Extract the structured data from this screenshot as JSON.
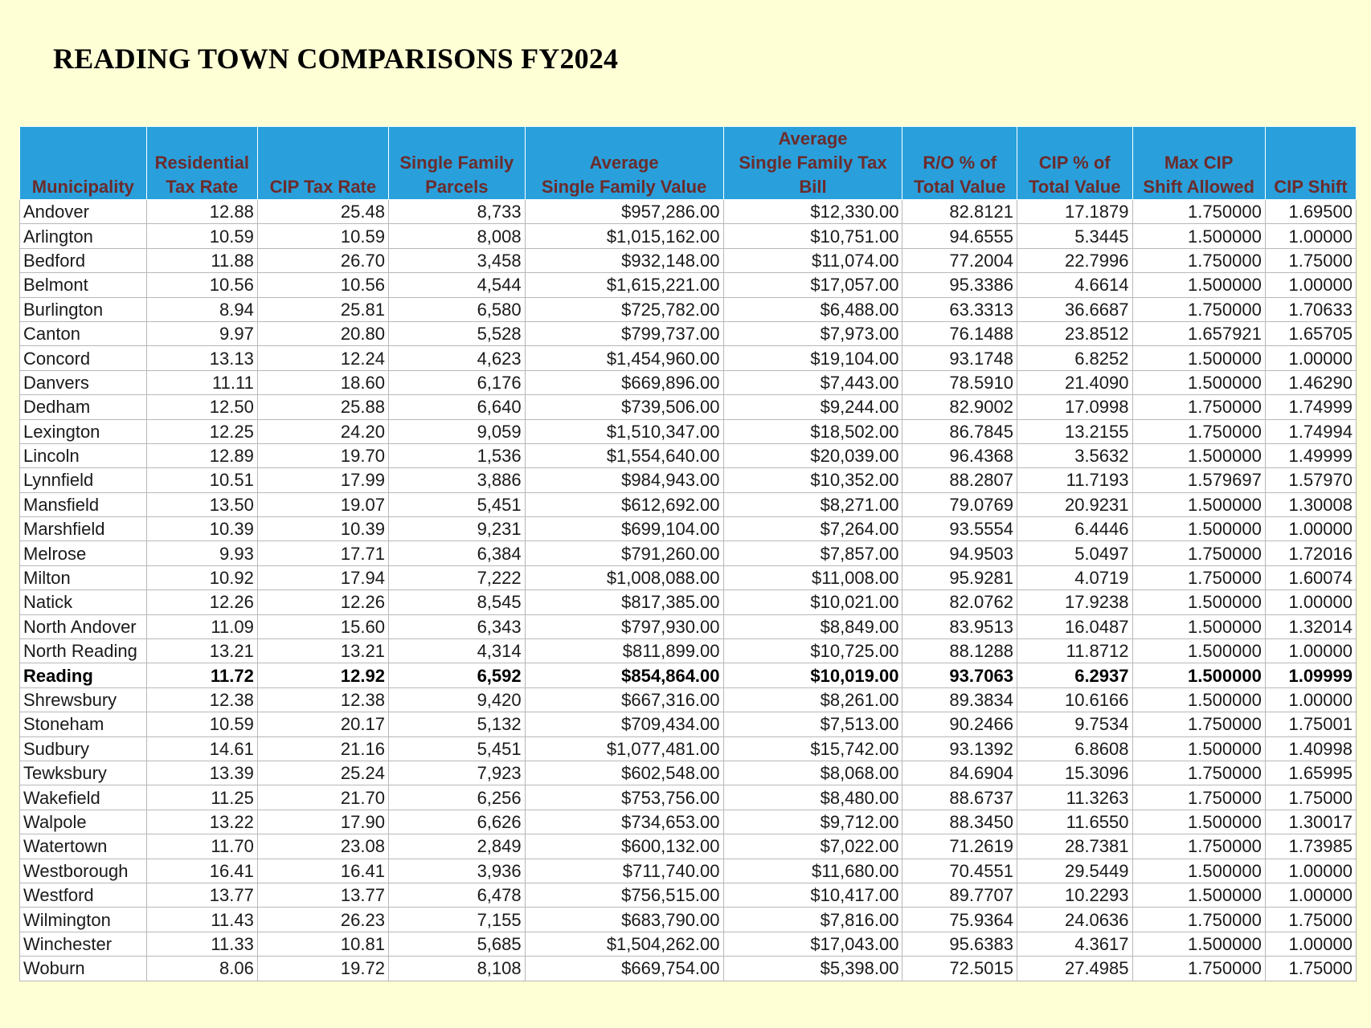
{
  "title": "READING TOWN COMPARISONS FY2024",
  "table": {
    "headers": [
      [
        "Municipality"
      ],
      [
        "Residential",
        "Tax Rate"
      ],
      [
        "CIP Tax Rate"
      ],
      [
        "Single Family",
        "Parcels"
      ],
      [
        "Average",
        "Single Family Value"
      ],
      [
        "Average",
        "Single Family Tax",
        "Bill"
      ],
      [
        "R/O % of",
        "Total Value"
      ],
      [
        "CIP % of",
        "Total Value"
      ],
      [
        "Max CIP",
        "Shift Allowed"
      ],
      [
        "CIP Shift"
      ]
    ],
    "highlight_row": "Reading",
    "rows": [
      [
        "Andover",
        "12.88",
        "25.48",
        "8,733",
        "$957,286.00",
        "$12,330.00",
        "82.8121",
        "17.1879",
        "1.750000",
        "1.69500"
      ],
      [
        "Arlington",
        "10.59",
        "10.59",
        "8,008",
        "$1,015,162.00",
        "$10,751.00",
        "94.6555",
        "5.3445",
        "1.500000",
        "1.00000"
      ],
      [
        "Bedford",
        "11.88",
        "26.70",
        "3,458",
        "$932,148.00",
        "$11,074.00",
        "77.2004",
        "22.7996",
        "1.750000",
        "1.75000"
      ],
      [
        "Belmont",
        "10.56",
        "10.56",
        "4,544",
        "$1,615,221.00",
        "$17,057.00",
        "95.3386",
        "4.6614",
        "1.500000",
        "1.00000"
      ],
      [
        "Burlington",
        "8.94",
        "25.81",
        "6,580",
        "$725,782.00",
        "$6,488.00",
        "63.3313",
        "36.6687",
        "1.750000",
        "1.70633"
      ],
      [
        "Canton",
        "9.97",
        "20.80",
        "5,528",
        "$799,737.00",
        "$7,973.00",
        "76.1488",
        "23.8512",
        "1.657921",
        "1.65705"
      ],
      [
        "Concord",
        "13.13",
        "12.24",
        "4,623",
        "$1,454,960.00",
        "$19,104.00",
        "93.1748",
        "6.8252",
        "1.500000",
        "1.00000"
      ],
      [
        "Danvers",
        "11.11",
        "18.60",
        "6,176",
        "$669,896.00",
        "$7,443.00",
        "78.5910",
        "21.4090",
        "1.500000",
        "1.46290"
      ],
      [
        "Dedham",
        "12.50",
        "25.88",
        "6,640",
        "$739,506.00",
        "$9,244.00",
        "82.9002",
        "17.0998",
        "1.750000",
        "1.74999"
      ],
      [
        "Lexington",
        "12.25",
        "24.20",
        "9,059",
        "$1,510,347.00",
        "$18,502.00",
        "86.7845",
        "13.2155",
        "1.750000",
        "1.74994"
      ],
      [
        "Lincoln",
        "12.89",
        "19.70",
        "1,536",
        "$1,554,640.00",
        "$20,039.00",
        "96.4368",
        "3.5632",
        "1.500000",
        "1.49999"
      ],
      [
        "Lynnfield",
        "10.51",
        "17.99",
        "3,886",
        "$984,943.00",
        "$10,352.00",
        "88.2807",
        "11.7193",
        "1.579697",
        "1.57970"
      ],
      [
        "Mansfield",
        "13.50",
        "19.07",
        "5,451",
        "$612,692.00",
        "$8,271.00",
        "79.0769",
        "20.9231",
        "1.500000",
        "1.30008"
      ],
      [
        "Marshfield",
        "10.39",
        "10.39",
        "9,231",
        "$699,104.00",
        "$7,264.00",
        "93.5554",
        "6.4446",
        "1.500000",
        "1.00000"
      ],
      [
        "Melrose",
        "9.93",
        "17.71",
        "6,384",
        "$791,260.00",
        "$7,857.00",
        "94.9503",
        "5.0497",
        "1.750000",
        "1.72016"
      ],
      [
        "Milton",
        "10.92",
        "17.94",
        "7,222",
        "$1,008,088.00",
        "$11,008.00",
        "95.9281",
        "4.0719",
        "1.750000",
        "1.60074"
      ],
      [
        "Natick",
        "12.26",
        "12.26",
        "8,545",
        "$817,385.00",
        "$10,021.00",
        "82.0762",
        "17.9238",
        "1.500000",
        "1.00000"
      ],
      [
        "North Andover",
        "11.09",
        "15.60",
        "6,343",
        "$797,930.00",
        "$8,849.00",
        "83.9513",
        "16.0487",
        "1.500000",
        "1.32014"
      ],
      [
        "North Reading",
        "13.21",
        "13.21",
        "4,314",
        "$811,899.00",
        "$10,725.00",
        "88.1288",
        "11.8712",
        "1.500000",
        "1.00000"
      ],
      [
        "Reading",
        "11.72",
        "12.92",
        "6,592",
        "$854,864.00",
        "$10,019.00",
        "93.7063",
        "6.2937",
        "1.500000",
        "1.09999"
      ],
      [
        "Shrewsbury",
        "12.38",
        "12.38",
        "9,420",
        "$667,316.00",
        "$8,261.00",
        "89.3834",
        "10.6166",
        "1.500000",
        "1.00000"
      ],
      [
        "Stoneham",
        "10.59",
        "20.17",
        "5,132",
        "$709,434.00",
        "$7,513.00",
        "90.2466",
        "9.7534",
        "1.750000",
        "1.75001"
      ],
      [
        "Sudbury",
        "14.61",
        "21.16",
        "5,451",
        "$1,077,481.00",
        "$15,742.00",
        "93.1392",
        "6.8608",
        "1.500000",
        "1.40998"
      ],
      [
        "Tewksbury",
        "13.39",
        "25.24",
        "7,923",
        "$602,548.00",
        "$8,068.00",
        "84.6904",
        "15.3096",
        "1.750000",
        "1.65995"
      ],
      [
        "Wakefield",
        "11.25",
        "21.70",
        "6,256",
        "$753,756.00",
        "$8,480.00",
        "88.6737",
        "11.3263",
        "1.750000",
        "1.75000"
      ],
      [
        "Walpole",
        "13.22",
        "17.90",
        "6,626",
        "$734,653.00",
        "$9,712.00",
        "88.3450",
        "11.6550",
        "1.500000",
        "1.30017"
      ],
      [
        "Watertown",
        "11.70",
        "23.08",
        "2,849",
        "$600,132.00",
        "$7,022.00",
        "71.2619",
        "28.7381",
        "1.750000",
        "1.73985"
      ],
      [
        "Westborough",
        "16.41",
        "16.41",
        "3,936",
        "$711,740.00",
        "$11,680.00",
        "70.4551",
        "29.5449",
        "1.500000",
        "1.00000"
      ],
      [
        "Westford",
        "13.77",
        "13.77",
        "6,478",
        "$756,515.00",
        "$10,417.00",
        "89.7707",
        "10.2293",
        "1.500000",
        "1.00000"
      ],
      [
        "Wilmington",
        "11.43",
        "26.23",
        "7,155",
        "$683,790.00",
        "$7,816.00",
        "75.9364",
        "24.0636",
        "1.750000",
        "1.75000"
      ],
      [
        "Winchester",
        "11.33",
        "10.81",
        "5,685",
        "$1,504,262.00",
        "$17,043.00",
        "95.6383",
        "4.3617",
        "1.500000",
        "1.00000"
      ],
      [
        "Woburn",
        "8.06",
        "19.72",
        "8,108",
        "$669,754.00",
        "$5,398.00",
        "72.5015",
        "27.4985",
        "1.750000",
        "1.75000"
      ]
    ]
  }
}
